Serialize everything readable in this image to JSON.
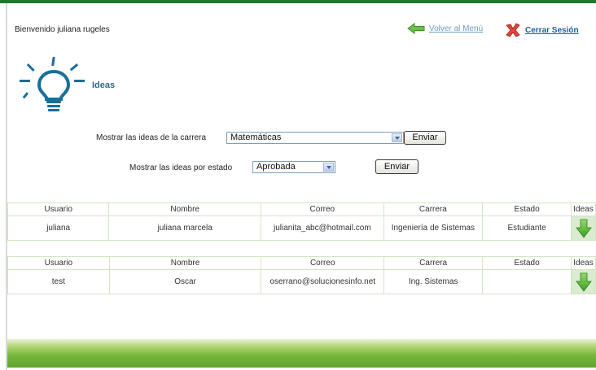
{
  "header": {
    "welcome": "Bienvenido juliana rugeles",
    "menu_link": "Volver al Menú",
    "logout_link": "Cerrar Sesión"
  },
  "section": {
    "title": "Ideas"
  },
  "filters": {
    "career_label": "Mostrar las ideas de la carrera",
    "career_value": "Matemáticas",
    "career_button": "Enviar",
    "state_label": "Mostrar las ideas por estado",
    "state_value": "Aprobada",
    "state_button": "Enviar"
  },
  "tables": [
    {
      "headers": [
        "Usuario",
        "Nombre",
        "Correo",
        "Carrera",
        "Estado",
        "Ideas"
      ],
      "row": [
        "juliana",
        "juliana marcela",
        "julianita_abc@hotmail.com",
        "Ingeniería de Sistemas",
        "Estudiante"
      ]
    },
    {
      "headers": [
        "Usuario",
        "Nombre",
        "Correo",
        "Carrera",
        "Estado",
        "Ideas"
      ],
      "row": [
        "test",
        "Oscar",
        "oserrano@solucionesinfo.net",
        "Ing. Sistemas",
        ""
      ]
    }
  ],
  "icons": {
    "menu": "green-back-arrow-icon",
    "logout": "red-x-icon",
    "logo": "lightbulb-icon",
    "ideas": "green-down-arrow-icon"
  },
  "colors": {
    "top_line": "#1b7b2c",
    "menu_link": "#6b9cc4",
    "logout_link": "#1f5e9e",
    "title": "#2b6b8f",
    "table_border": "#d3e6c4",
    "footer": "#74b53a"
  }
}
